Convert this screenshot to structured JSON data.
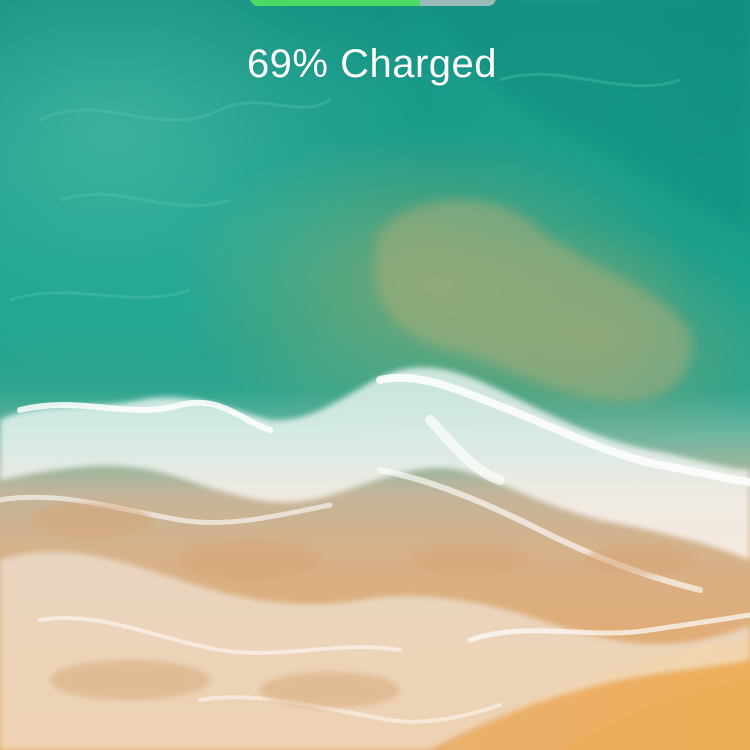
{
  "lockscreen": {
    "charge_label": "69% Charged",
    "battery_level_percent": 69,
    "battery_fill_color": "#4cd964",
    "wallpaper": "aerial-beach-ocean-wave"
  }
}
